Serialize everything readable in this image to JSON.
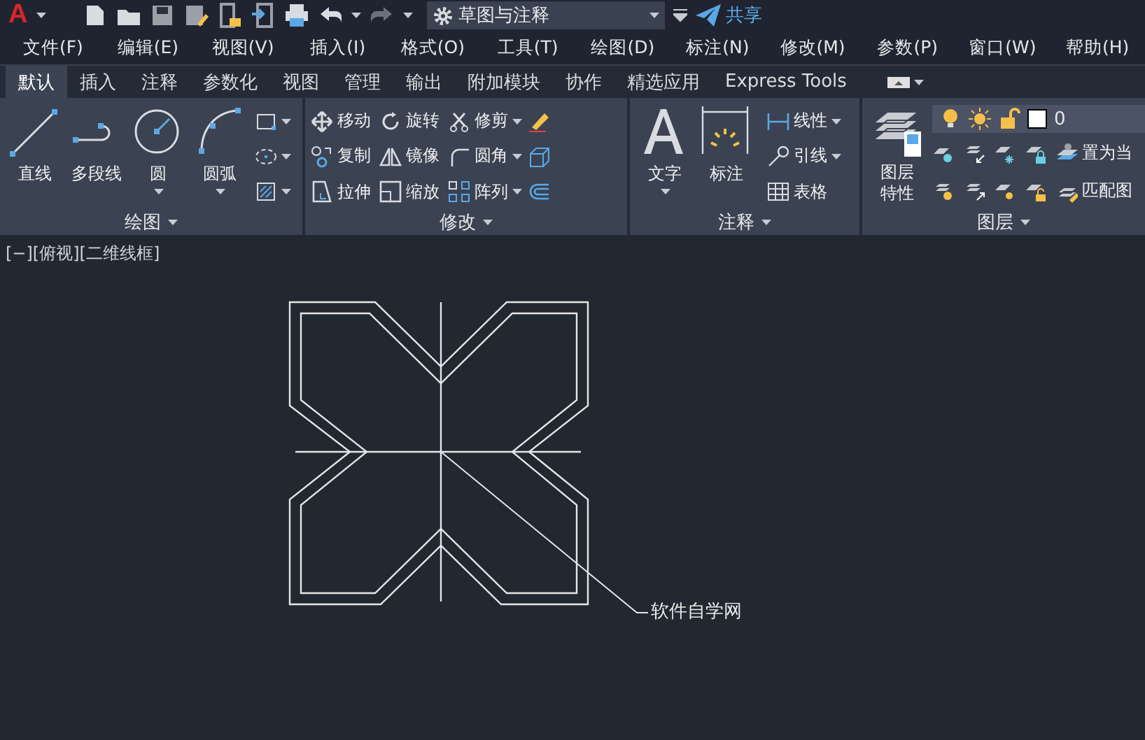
{
  "app": {
    "logo": "A",
    "workspace": "草图与注释",
    "share": "共享"
  },
  "menu": [
    "文件(F)",
    "编辑(E)",
    "视图(V)",
    "插入(I)",
    "格式(O)",
    "工具(T)",
    "绘图(D)",
    "标注(N)",
    "修改(M)",
    "参数(P)",
    "窗口(W)",
    "帮助(H)"
  ],
  "ribbon_tabs": [
    {
      "label": "默认",
      "selected": true
    },
    {
      "label": "插入",
      "selected": false
    },
    {
      "label": "注释",
      "selected": false
    },
    {
      "label": "参数化",
      "selected": false
    },
    {
      "label": "视图",
      "selected": false
    },
    {
      "label": "管理",
      "selected": false
    },
    {
      "label": "输出",
      "selected": false
    },
    {
      "label": "附加模块",
      "selected": false
    },
    {
      "label": "协作",
      "selected": false
    },
    {
      "label": "精选应用",
      "selected": false
    },
    {
      "label": "Express Tools",
      "selected": false
    }
  ],
  "panels": [
    {
      "kind": "draw",
      "title": "绘图",
      "large_tools": [
        {
          "label": "直线",
          "dropdown": false
        },
        {
          "label": "多段线",
          "dropdown": false
        },
        {
          "label": "圆",
          "dropdown": true
        },
        {
          "label": "圆弧",
          "dropdown": true
        }
      ]
    },
    {
      "kind": "modify",
      "title": "修改",
      "tools": [
        {
          "label": "移动",
          "dropdown": false
        },
        {
          "label": "旋转",
          "dropdown": false
        },
        {
          "label": "修剪",
          "dropdown": true
        },
        {
          "label": "复制",
          "dropdown": false
        },
        {
          "label": "镜像",
          "dropdown": false
        },
        {
          "label": "圆角",
          "dropdown": true
        },
        {
          "label": "拉伸",
          "dropdown": false
        },
        {
          "label": "缩放",
          "dropdown": false
        },
        {
          "label": "阵列",
          "dropdown": true
        }
      ]
    },
    {
      "kind": "annotate",
      "title": "注释",
      "large_tools": [
        {
          "label": "文字",
          "dropdown": true
        },
        {
          "label": "标注",
          "dropdown": false
        }
      ],
      "tools": [
        {
          "label": "线性",
          "dropdown": true
        },
        {
          "label": "引线",
          "dropdown": true
        },
        {
          "label": "表格",
          "dropdown": false
        }
      ]
    },
    {
      "kind": "layers",
      "title": "图层",
      "large_tools": [
        {
          "label": "图层特性",
          "dropdown": false
        }
      ],
      "current_layer": "0",
      "tools": [
        {
          "label": "置为当",
          "dropdown": false
        },
        {
          "label": "匹配图",
          "dropdown": false
        }
      ]
    }
  ],
  "viewport": {
    "label": "[−][俯视][二维线框]",
    "leader_text": "软件自学网"
  }
}
